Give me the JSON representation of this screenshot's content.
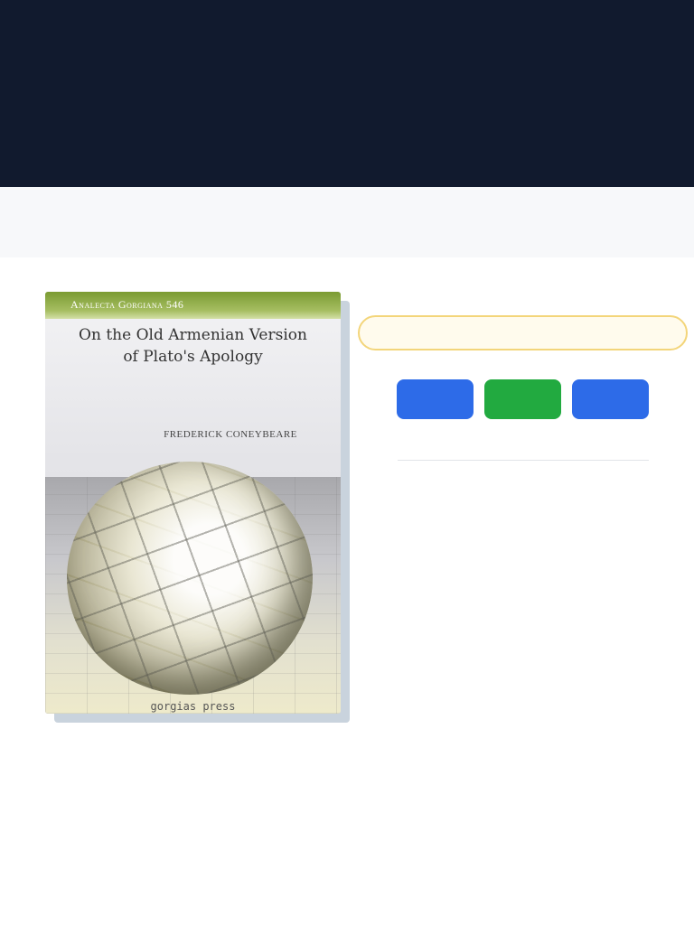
{
  "colors": {
    "top_bar": "#111a2e",
    "sub_bar": "#f7f8fa",
    "notice_border": "#f3d57a",
    "button_primary": "#2d6be8",
    "button_green": "#22aa40"
  },
  "book": {
    "series": "Analecta Gorgiana 546",
    "title_line1": "On the Old Armenian Version",
    "title_line2": "of Plato's Apology",
    "author": "FREDERICK CONEYBEARE",
    "publisher": "gorgias press"
  },
  "notice": {
    "text": ""
  },
  "actions": [
    {
      "label": "",
      "color": "#2d6be8"
    },
    {
      "label": "",
      "color": "#22aa40"
    },
    {
      "label": "",
      "color": "#2d6be8"
    }
  ]
}
